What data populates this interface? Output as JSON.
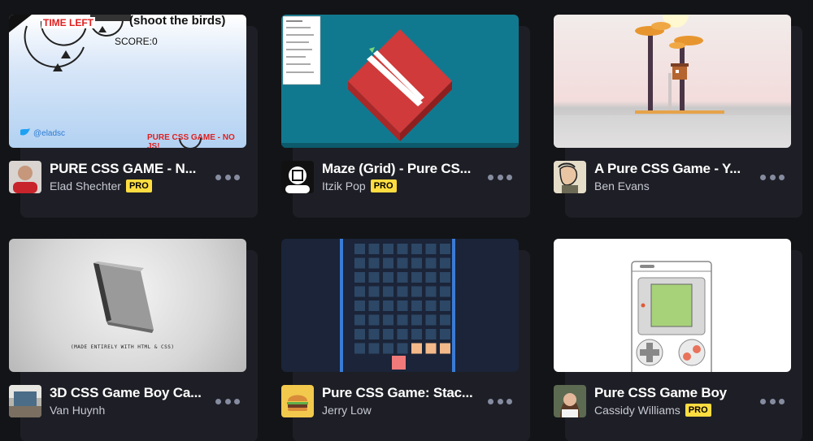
{
  "cards": [
    {
      "title": "PURE CSS GAME - N...",
      "author": "Elad Shechter",
      "pro": "PRO",
      "thumb_text": {
        "time_left": "TIME LEFT",
        "shoot": "(shoot the birds)",
        "score": "SCORE:0",
        "handle": "@eladsc",
        "footer": "PURE CSS GAME - NO JS!"
      }
    },
    {
      "title": "Maze (Grid) - Pure CS...",
      "author": "Itzik Pop",
      "pro": "PRO"
    },
    {
      "title": "A Pure CSS Game - Y...",
      "author": "Ben Evans"
    },
    {
      "title": "3D CSS Game Boy Ca...",
      "author": "Van Huynh",
      "thumb_text": {
        "caption": "(MADE ENTIRELY WITH HTML & CSS)"
      }
    },
    {
      "title": "Pure CSS Game: Stac...",
      "author": "Jerry Low"
    },
    {
      "title": "Pure CSS Game Boy",
      "author": "Cassidy Williams",
      "pro": "PRO"
    }
  ],
  "colors": {
    "background": "#131417",
    "card": "#1e1f26",
    "pro_badge": "#ffdd40",
    "maze_bg": "#11798f",
    "maze_cube": "#d03a3a",
    "stack_bg": "#1b2438",
    "gameboy_screen": "#a8d27a"
  }
}
